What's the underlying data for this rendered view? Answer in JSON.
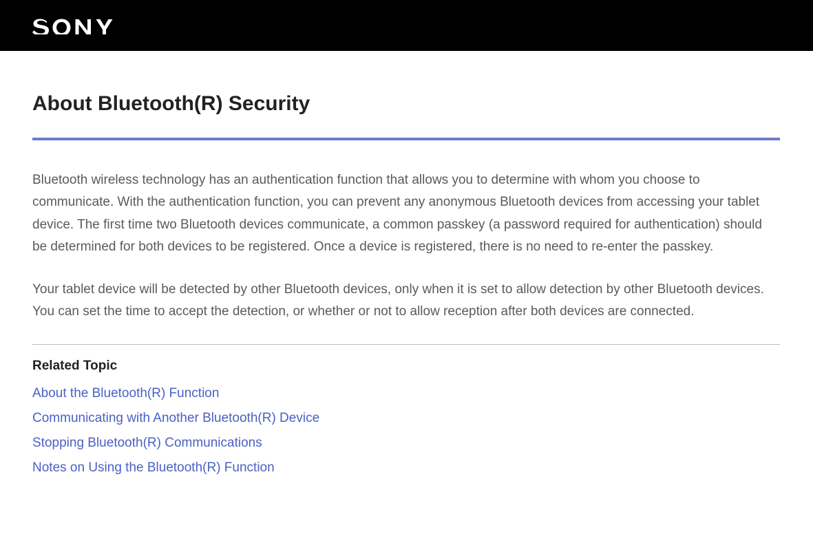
{
  "header": {
    "brand": "SONY"
  },
  "page": {
    "title": "About Bluetooth(R) Security",
    "paragraphs": [
      "Bluetooth wireless technology has an authentication function that allows you to determine with whom you choose to communicate. With the authentication function, you can prevent any anonymous Bluetooth devices from accessing your tablet device. The first time two Bluetooth devices communicate, a common passkey (a password required for authentication) should be determined for both devices to be registered. Once a device is registered, there is no need to re-enter the passkey.",
      "Your tablet device will be detected by other Bluetooth devices, only when it is set to allow detection by other Bluetooth devices. You can set the time to accept the detection, or whether or not to allow reception after both devices are connected."
    ]
  },
  "related": {
    "heading": "Related Topic",
    "links": [
      "About the Bluetooth(R) Function",
      "Communicating with Another Bluetooth(R) Device",
      "Stopping Bluetooth(R) Communications",
      "Notes on Using the Bluetooth(R) Function"
    ]
  }
}
